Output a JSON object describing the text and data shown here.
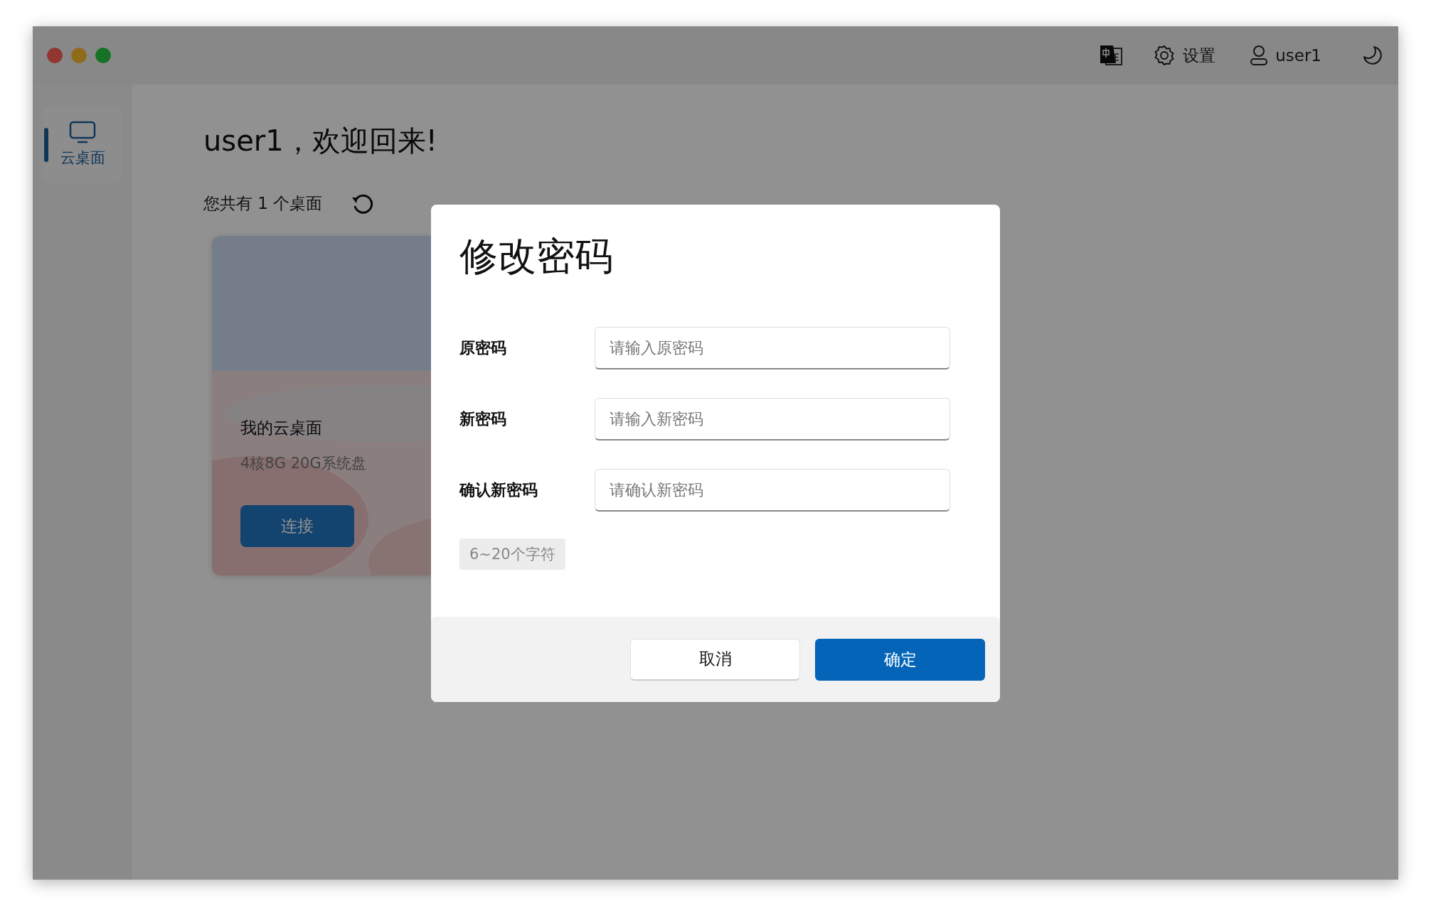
{
  "toolbar": {
    "settings_label": "设置",
    "user_label": "user1"
  },
  "sidebar": {
    "items": [
      {
        "label": "云桌面",
        "selected": true
      }
    ]
  },
  "main": {
    "greeting": "user1，欢迎回来!",
    "count_text": "您共有 1 个桌面",
    "desktops": [
      {
        "name": "我的云桌面",
        "specs": "4核8G 20G系统盘",
        "button": "连接"
      }
    ]
  },
  "dialog": {
    "title": "修改密码",
    "fields": [
      {
        "label": "原密码",
        "placeholder": "请输入原密码"
      },
      {
        "label": "新密码",
        "placeholder": "请输入新密码"
      },
      {
        "label": "确认新密码",
        "placeholder": "请确认新密码"
      }
    ],
    "hint": "6~20个字符",
    "buttons": [
      {
        "label": "取消",
        "kind": "secondary"
      },
      {
        "label": "确定",
        "kind": "primary"
      }
    ]
  }
}
